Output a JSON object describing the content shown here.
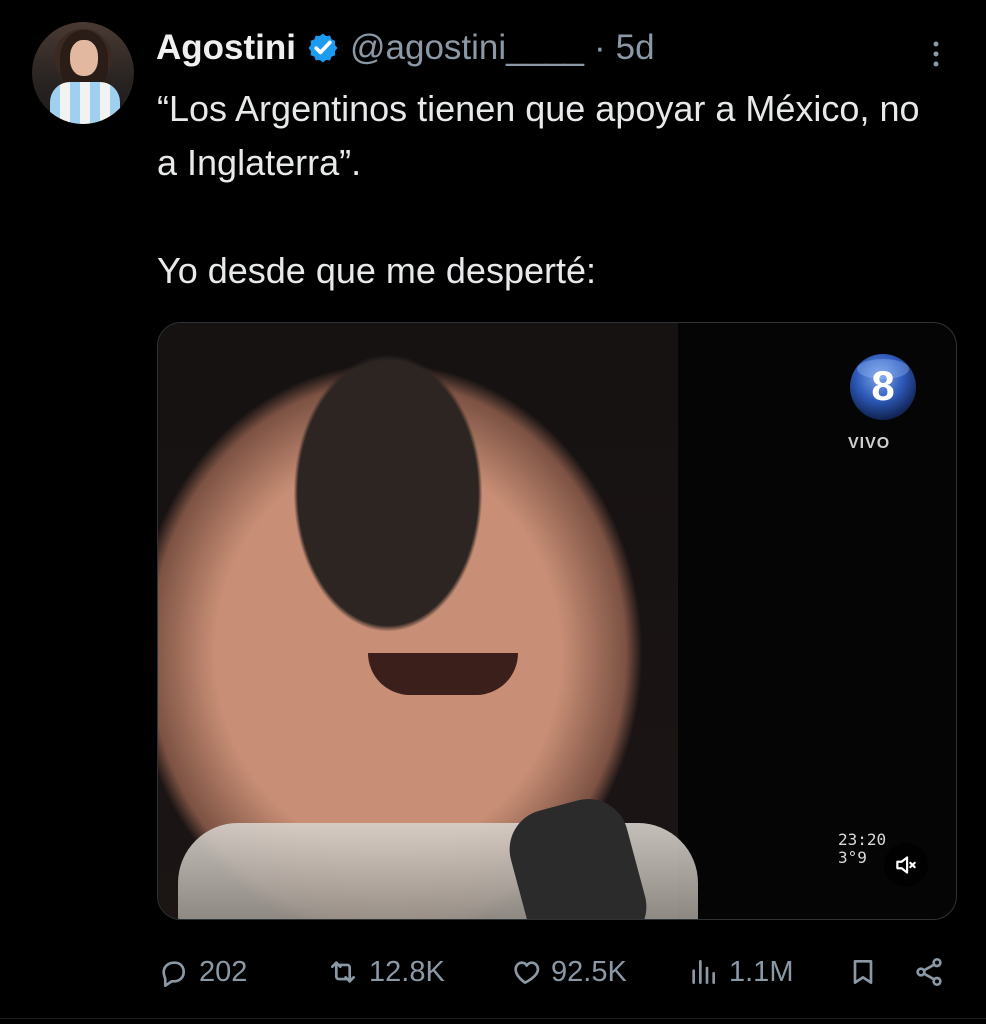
{
  "post": {
    "author_name": "Agostini",
    "handle": "@agostini____",
    "separator": "·",
    "time": "5d",
    "text": "“Los Argentinos tienen que apoyar a México, no a Inglaterra”.\n\nYo desde que me desperté:"
  },
  "media": {
    "channel_number": "8",
    "channel_label": "VIVO",
    "timestamp_1": "23:20",
    "timestamp_2": "3°9"
  },
  "actions": {
    "replies": "202",
    "reposts": "12.8K",
    "likes": "92.5K",
    "views": "1.1M"
  },
  "colors": {
    "background": "#000000",
    "text": "#e7e9ea",
    "muted": "#8b98a5",
    "verified": "#1d9bf0"
  },
  "icons": {
    "verified": "verified-badge-icon",
    "more": "more-icon",
    "reply": "reply-icon",
    "repost": "repost-icon",
    "like": "like-icon",
    "views": "views-icon",
    "bookmark": "bookmark-icon",
    "share": "share-icon",
    "mute": "muted-volume-icon"
  }
}
